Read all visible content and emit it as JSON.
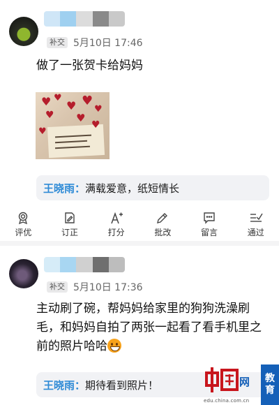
{
  "posts": [
    {
      "badge": "补交",
      "date": "5月10日 17:46",
      "text": "做了一张贺卡给妈妈",
      "comment": {
        "author": "王晓雨：",
        "text": "满载爱意，纸短情长"
      },
      "actions": [
        {
          "label": "评优",
          "icon": "medal-icon"
        },
        {
          "label": "订正",
          "icon": "edit-doc-icon"
        },
        {
          "label": "打分",
          "icon": "score-icon"
        },
        {
          "label": "批改",
          "icon": "pencil-icon"
        },
        {
          "label": "留言",
          "icon": "message-icon"
        },
        {
          "label": "通过",
          "icon": "check-list-icon"
        }
      ]
    },
    {
      "badge": "补交",
      "date": "5月10日 17:36",
      "text": "主动刷了碗，帮妈妈给家里的狗狗洗澡刷毛，和妈妈自拍了两张一起看了看手机里之前的照片哈哈",
      "comment": {
        "author": "王晓雨：",
        "text": "期待看到照片！"
      }
    }
  ],
  "watermark": {
    "brand": "中国网",
    "edu": "教育",
    "url": "edu.china.com.cn"
  },
  "colors": {
    "accent": "#2f8bd6",
    "brand_red": "#c8161d",
    "edu_blue": "#1560b8"
  }
}
